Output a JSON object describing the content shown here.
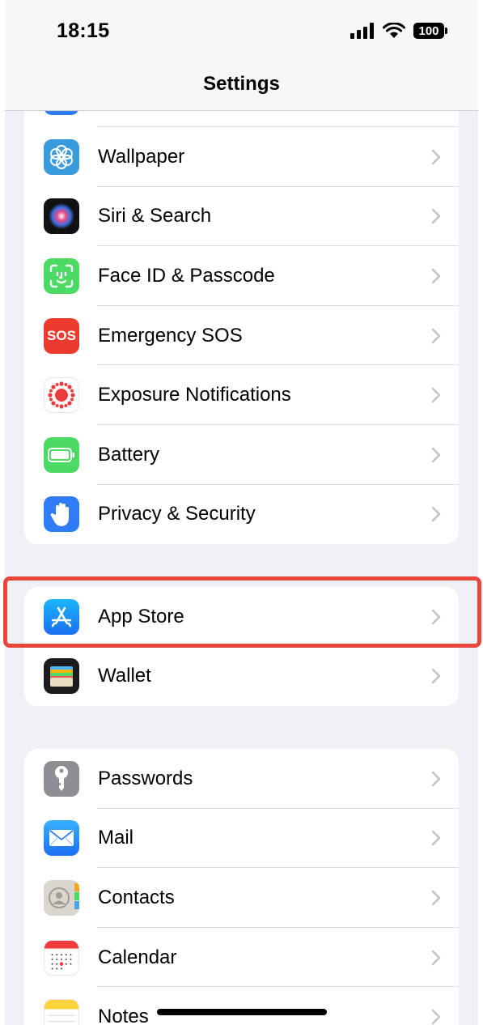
{
  "status_bar": {
    "time": "18:15",
    "battery": "100"
  },
  "nav": {
    "title": "Settings"
  },
  "groups": [
    {
      "items": [
        {
          "label": "Wallpaper",
          "icon": "wallpaper-icon",
          "color": "#3a9bdc"
        },
        {
          "label": "Siri & Search",
          "icon": "siri-icon",
          "color": "#1a1a2e"
        },
        {
          "label": "Face ID & Passcode",
          "icon": "face-id-icon",
          "color": "#4cd964"
        },
        {
          "label": "Emergency SOS",
          "icon": "sos-icon",
          "color": "#ec3b2e",
          "icon_text": "SOS"
        },
        {
          "label": "Exposure Notifications",
          "icon": "exposure-notifications-icon",
          "color": "#ffffff"
        },
        {
          "label": "Battery",
          "icon": "battery-icon",
          "color": "#4cd964"
        },
        {
          "label": "Privacy & Security",
          "icon": "hand-icon",
          "color": "#2f7cf6"
        }
      ]
    },
    {
      "items": [
        {
          "label": "App Store",
          "icon": "app-store-icon",
          "color": "#1a8cf5"
        },
        {
          "label": "Wallet",
          "icon": "wallet-icon",
          "color": "#1c1c1e"
        }
      ]
    },
    {
      "items": [
        {
          "label": "Passwords",
          "icon": "key-icon",
          "color": "#8e8e93"
        },
        {
          "label": "Mail",
          "icon": "mail-icon",
          "color": "#2f8ef4"
        },
        {
          "label": "Contacts",
          "icon": "contacts-icon",
          "color": "#d9d6d0"
        },
        {
          "label": "Calendar",
          "icon": "calendar-icon",
          "color": "#ffffff"
        },
        {
          "label": "Notes",
          "icon": "notes-icon",
          "color": "#ffffff"
        }
      ]
    }
  ],
  "colors": {
    "highlight": "#e8463b",
    "background": "#f1f0f5",
    "chevron": "#c4c4c7"
  }
}
